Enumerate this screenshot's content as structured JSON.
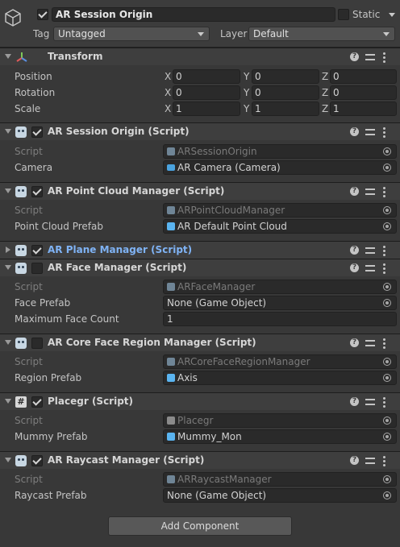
{
  "header": {
    "object_name": "AR Session Origin",
    "static_label": "Static",
    "tag_label": "Tag",
    "tag_value": "Untagged",
    "layer_label": "Layer",
    "layer_value": "Default",
    "active": true,
    "static": false
  },
  "transform": {
    "title": "Transform",
    "rows": [
      {
        "label": "Position",
        "x": "0",
        "y": "0",
        "z": "0"
      },
      {
        "label": "Rotation",
        "x": "0",
        "y": "0",
        "z": "0"
      },
      {
        "label": "Scale",
        "x": "1",
        "y": "1",
        "z": "1"
      }
    ],
    "axis_x": "X",
    "axis_y": "Y",
    "axis_z": "Z"
  },
  "components": [
    {
      "title": "AR Session Origin (Script)",
      "enabled": true,
      "script_label": "Script",
      "script_value": "ARSessionOrigin",
      "fields": [
        {
          "label": "Camera",
          "value": "AR Camera (Camera)",
          "icon": "camera-icon"
        }
      ]
    },
    {
      "title": "AR Point Cloud Manager (Script)",
      "enabled": true,
      "script_label": "Script",
      "script_value": "ARPointCloudManager",
      "fields": [
        {
          "label": "Point Cloud Prefab",
          "value": "AR Default Point Cloud",
          "icon": "prefab-icon"
        }
      ]
    },
    {
      "title": "AR Plane Manager (Script)",
      "enabled": true,
      "collapsed": true
    },
    {
      "title": "AR Face Manager (Script)",
      "enabled": false,
      "script_label": "Script",
      "script_value": "ARFaceManager",
      "fields": [
        {
          "label": "Face Prefab",
          "value": "None (Game Object)"
        },
        {
          "label": "Maximum Face Count",
          "value": "1"
        }
      ]
    },
    {
      "title": "AR Core Face Region Manager (Script)",
      "enabled": false,
      "script_label": "Script",
      "script_value": "ARCoreFaceRegionManager",
      "fields": [
        {
          "label": "Region Prefab",
          "value": "Axis",
          "icon": "prefab-icon"
        }
      ]
    },
    {
      "title": "Placegr (Script)",
      "enabled": true,
      "script_label": "Script",
      "script_value": "Placegr",
      "fields": [
        {
          "label": "Mummy Prefab",
          "value": "Mummy_Mon",
          "icon": "prefab-icon"
        }
      ]
    },
    {
      "title": "AR Raycast Manager (Script)",
      "enabled": true,
      "script_label": "Script",
      "script_value": "ARRaycastManager",
      "fields": [
        {
          "label": "Raycast Prefab",
          "value": "None (Game Object)"
        }
      ]
    }
  ],
  "add_component_label": "Add Component",
  "colors": {
    "background": "#383838",
    "selected_title": "#7fb3f5",
    "prefab_icon": "#5ab4f0"
  }
}
